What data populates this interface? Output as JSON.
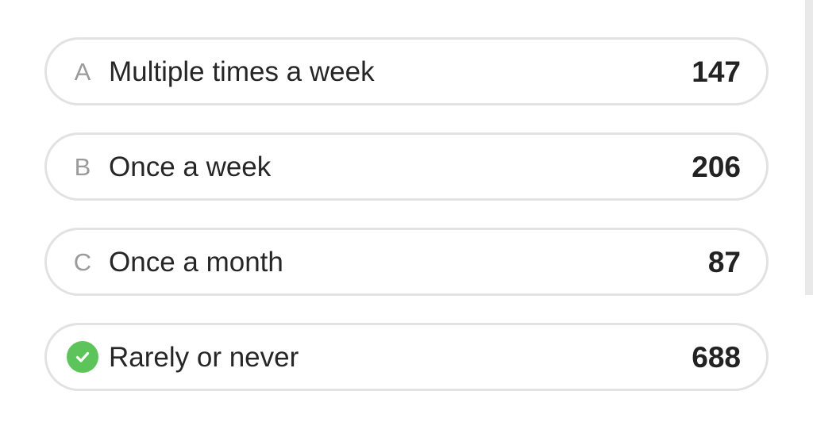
{
  "poll": {
    "options": [
      {
        "marker": "A",
        "label": "Multiple times a week",
        "count": "147",
        "selected": false
      },
      {
        "marker": "B",
        "label": "Once a week",
        "count": "206",
        "selected": false
      },
      {
        "marker": "C",
        "label": "Once a month",
        "count": "87",
        "selected": false
      },
      {
        "marker": "",
        "marker_icon": "check-circle-icon",
        "label": "Rarely or never",
        "count": "688",
        "selected": true
      }
    ]
  },
  "colors": {
    "border": "#e2e2e2",
    "selected_check": "#5dc45b",
    "letter": "#9a9a9a",
    "text": "#262626"
  }
}
